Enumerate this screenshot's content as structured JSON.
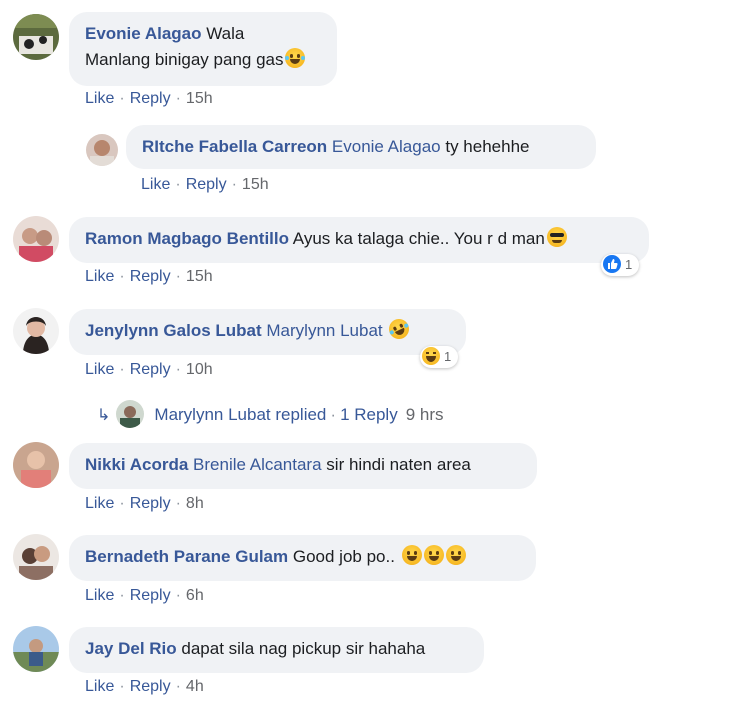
{
  "comments": [
    {
      "author": "Evonie Alagao",
      "line1": "Wala",
      "line2": "Manlang binigay pang gas",
      "emoji": "laughing-face",
      "like": "Like",
      "reply": "Reply",
      "time": "15h"
    },
    {
      "author": "RItche Fabella Carreon",
      "mention": "Evonie Alagao",
      "text": "ty hehehhe",
      "like": "Like",
      "reply": "Reply",
      "time": "15h"
    },
    {
      "author": "Ramon Magbago Bentillo",
      "text": "Ayus ka talaga chie.. You r d man",
      "emoji": "sunglasses-face",
      "reaction_count": "1",
      "reaction_type": "like",
      "like": "Like",
      "reply": "Reply",
      "time": "15h"
    },
    {
      "author": "Jenylynn Galos Lubat",
      "mention": "Marylynn Lubat",
      "emoji": "rolling-laughing-face",
      "reaction_count": "1",
      "reaction_type": "haha",
      "like": "Like",
      "reply": "Reply",
      "time": "10h",
      "replied_by": "Marylynn Lubat replied",
      "replies_link": "1 Reply",
      "replies_time": "9 hrs"
    },
    {
      "author": "Nikki Acorda",
      "mention": "Brenile Alcantara",
      "text": "sir hindi naten area",
      "like": "Like",
      "reply": "Reply",
      "time": "8h"
    },
    {
      "author": "Bernadeth Parane Gulam",
      "text": "Good job po..",
      "emoji": "laughing-face",
      "like": "Like",
      "reply": "Reply",
      "time": "6h"
    },
    {
      "author": "Jay Del Rio",
      "text": "dapat sila nag pickup sir hahaha",
      "like": "Like",
      "reply": "Reply",
      "time": "4h"
    }
  ],
  "colors": {
    "link": "#385898",
    "bubble": "#f0f2f5",
    "meta": "#65676b",
    "like_reaction": "#1877f2"
  }
}
